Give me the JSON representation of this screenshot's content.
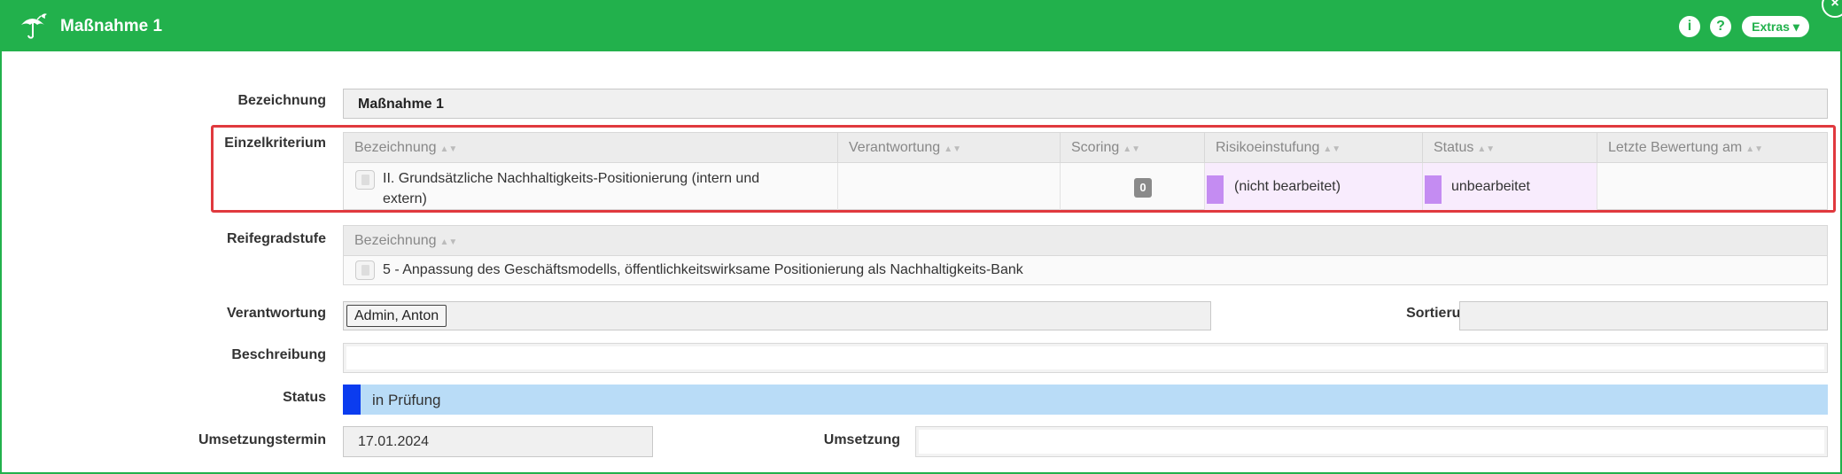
{
  "window": {
    "title": "Maßnahme 1"
  },
  "titlebar": {
    "info_glyph": "i",
    "help_glyph": "?",
    "extras_label": "Extras ▾",
    "close_glyph": "×"
  },
  "form": {
    "bezeichnung": {
      "label": "Bezeichnung",
      "value": "Maßnahme 1"
    },
    "einzelkriterium": {
      "label": "Einzelkriterium",
      "columns": [
        "Bezeichnung",
        "Verantwortung",
        "Scoring",
        "Risikoeinstufung",
        "Status",
        "Letzte Bewertung am"
      ],
      "row": {
        "bezeichnung_line1": "II. Grundsätzliche Nachhaltigkeits-Positionierung (intern und",
        "bezeichnung_line2": "extern)",
        "verantwortung": "",
        "scoring": "0",
        "risikoeinstufung": "(nicht bearbeitet)",
        "status": "unbearbeitet",
        "letzte_bewertung": ""
      }
    },
    "reifegradstufe": {
      "label": "Reifegradstufe",
      "column": "Bezeichnung",
      "row": "5 - Anpassung des Geschäftsmodells, öffentlichkeitswirksame Positionierung als Nachhaltigkeits-Bank"
    },
    "verantwortung": {
      "label": "Verantwortung",
      "value": "Admin, Anton"
    },
    "sortierung": {
      "label": "Sortierung",
      "value": ""
    },
    "beschreibung": {
      "label": "Beschreibung",
      "value": ""
    },
    "status": {
      "label": "Status",
      "value": "in Prüfung"
    },
    "umsetzungstermin": {
      "label": "Umsetzungstermin",
      "value": "17.01.2024"
    },
    "umsetzung": {
      "label": "Umsetzung",
      "value": ""
    }
  },
  "colors": {
    "titlebar": "#22b14c",
    "risk_swatch": "#c48cf2",
    "risk_cell_bg": "#f8ecfd",
    "status_swatch": "#0b3cef",
    "status_bg": "#b9dcf7",
    "highlight": "#e0393e"
  },
  "icons": [
    "umbrella-bird-icon",
    "info-icon",
    "help-icon",
    "close-icon",
    "document-icon",
    "sort-icon"
  ]
}
